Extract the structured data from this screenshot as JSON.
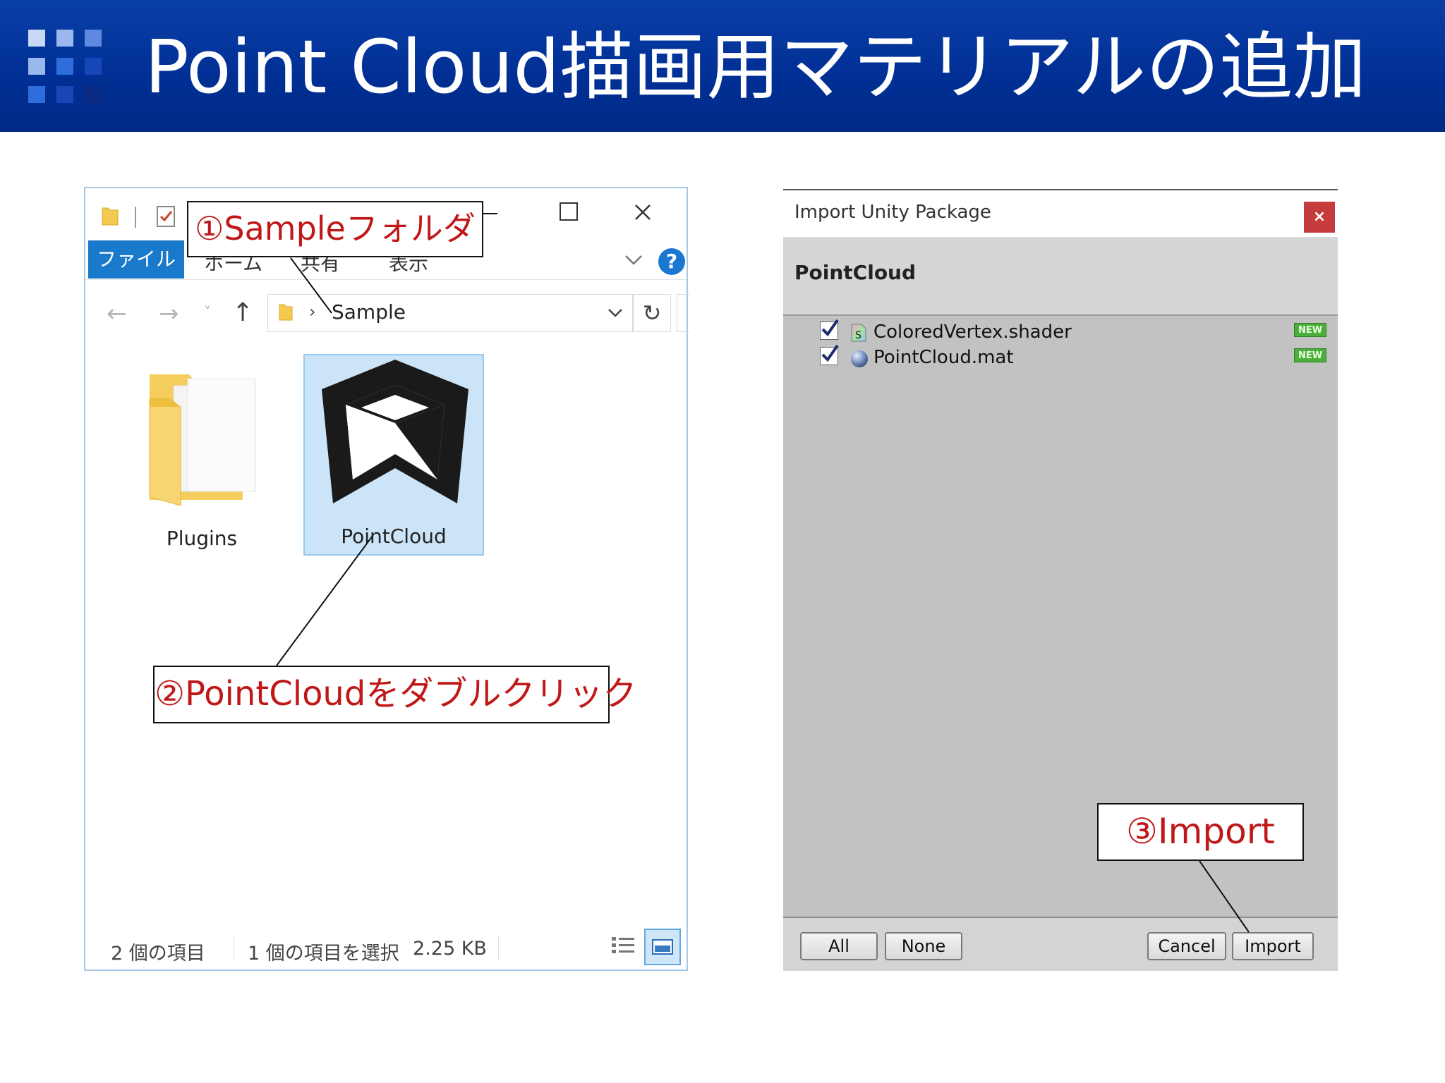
{
  "slide": {
    "title": "Point Cloud描画用マテリアルの追加",
    "title_bar_color": "#0035a0"
  },
  "explorer": {
    "ribbon_tabs": {
      "file": "ファイル",
      "home": "ホーム",
      "share": "共有",
      "view": "表示"
    },
    "help_label": "?",
    "address": {
      "separator": "›",
      "path": "Sample"
    },
    "nav": {
      "back": "←",
      "forward": "→",
      "recent": "˅",
      "up": "↑",
      "refresh": "↻"
    },
    "items": [
      {
        "label": "Plugins",
        "icon": "folder-icon",
        "selected": false
      },
      {
        "label": "PointCloud",
        "icon": "unity-logo-icon",
        "selected": true
      }
    ],
    "status": {
      "count": "2 個の項目",
      "selected": "1 個の項目を選択",
      "size": "2.25 KB"
    }
  },
  "callouts": {
    "step1": "①Sampleフォルダ",
    "step2": "②PointCloudをダブルクリック",
    "step3": "③Import",
    "text_color": "#c01818"
  },
  "unity_dialog": {
    "title": "Import Unity Package",
    "close_label": "×",
    "package_name": "PointCloud",
    "files": [
      {
        "name": "ColoredVertex.shader",
        "checked": true,
        "icon": "shader-icon",
        "badge": "NEW"
      },
      {
        "name": "PointCloud.mat",
        "checked": true,
        "icon": "material-sphere-icon",
        "badge": "NEW"
      }
    ],
    "buttons": {
      "all": "All",
      "none": "None",
      "cancel": "Cancel",
      "import": "Import"
    }
  }
}
